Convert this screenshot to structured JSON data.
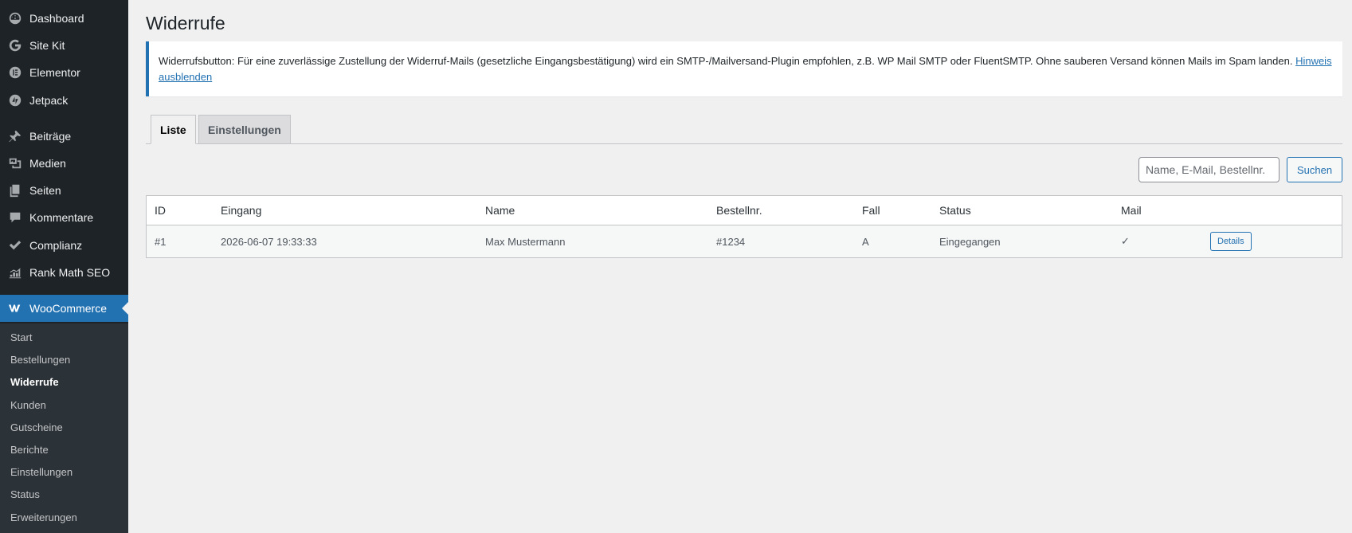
{
  "sidebar": {
    "items": [
      {
        "label": "Dashboard",
        "icon": "dashboard-icon"
      },
      {
        "label": "Site Kit",
        "icon": "google-g-icon"
      },
      {
        "label": "Elementor",
        "icon": "elementor-icon"
      },
      {
        "label": "Jetpack",
        "icon": "jetpack-icon"
      },
      {
        "label": "Beiträge",
        "icon": "pin-icon"
      },
      {
        "label": "Medien",
        "icon": "media-icon"
      },
      {
        "label": "Seiten",
        "icon": "pages-icon"
      },
      {
        "label": "Kommentare",
        "icon": "comment-icon"
      },
      {
        "label": "Complianz",
        "icon": "checkmark-icon"
      },
      {
        "label": "Rank Math SEO",
        "icon": "chart-icon"
      },
      {
        "label": "WooCommerce",
        "icon": "woo-icon"
      }
    ],
    "submenu": [
      "Start",
      "Bestellungen",
      "Widerrufe",
      "Kunden",
      "Gutscheine",
      "Berichte",
      "Einstellungen",
      "Status",
      "Erweiterungen"
    ]
  },
  "page": {
    "title": "Widerrufe"
  },
  "notice": {
    "text": "Widerrufsbutton: Für eine zuverlässige Zustellung der Widerruf-Mails (gesetzliche Eingangsbestätigung) wird ein SMTP-/Mailversand-Plugin empfohlen, z.B. WP Mail SMTP oder FluentSMTP. Ohne sauberen Versand können Mails im Spam landen.",
    "link": "Hinweis ausblenden"
  },
  "tabs": {
    "list": "Liste",
    "settings": "Einstellungen"
  },
  "search": {
    "placeholder": "Name, E-Mail, Bestellnr.",
    "button": "Suchen"
  },
  "table": {
    "columns": [
      "ID",
      "Eingang",
      "Name",
      "Bestellnr.",
      "Fall",
      "Status",
      "Mail"
    ],
    "rows": [
      {
        "id": "#1",
        "eingang": "2026-06-07 19:33:33",
        "name": "Max Mustermann",
        "bestellnr": "#1234",
        "fall": "A",
        "status": "Eingegangen",
        "mail": "✓",
        "action": "Details"
      }
    ]
  },
  "colors": {
    "sidebar_bg": "#1d2327",
    "accent": "#2271b1"
  }
}
